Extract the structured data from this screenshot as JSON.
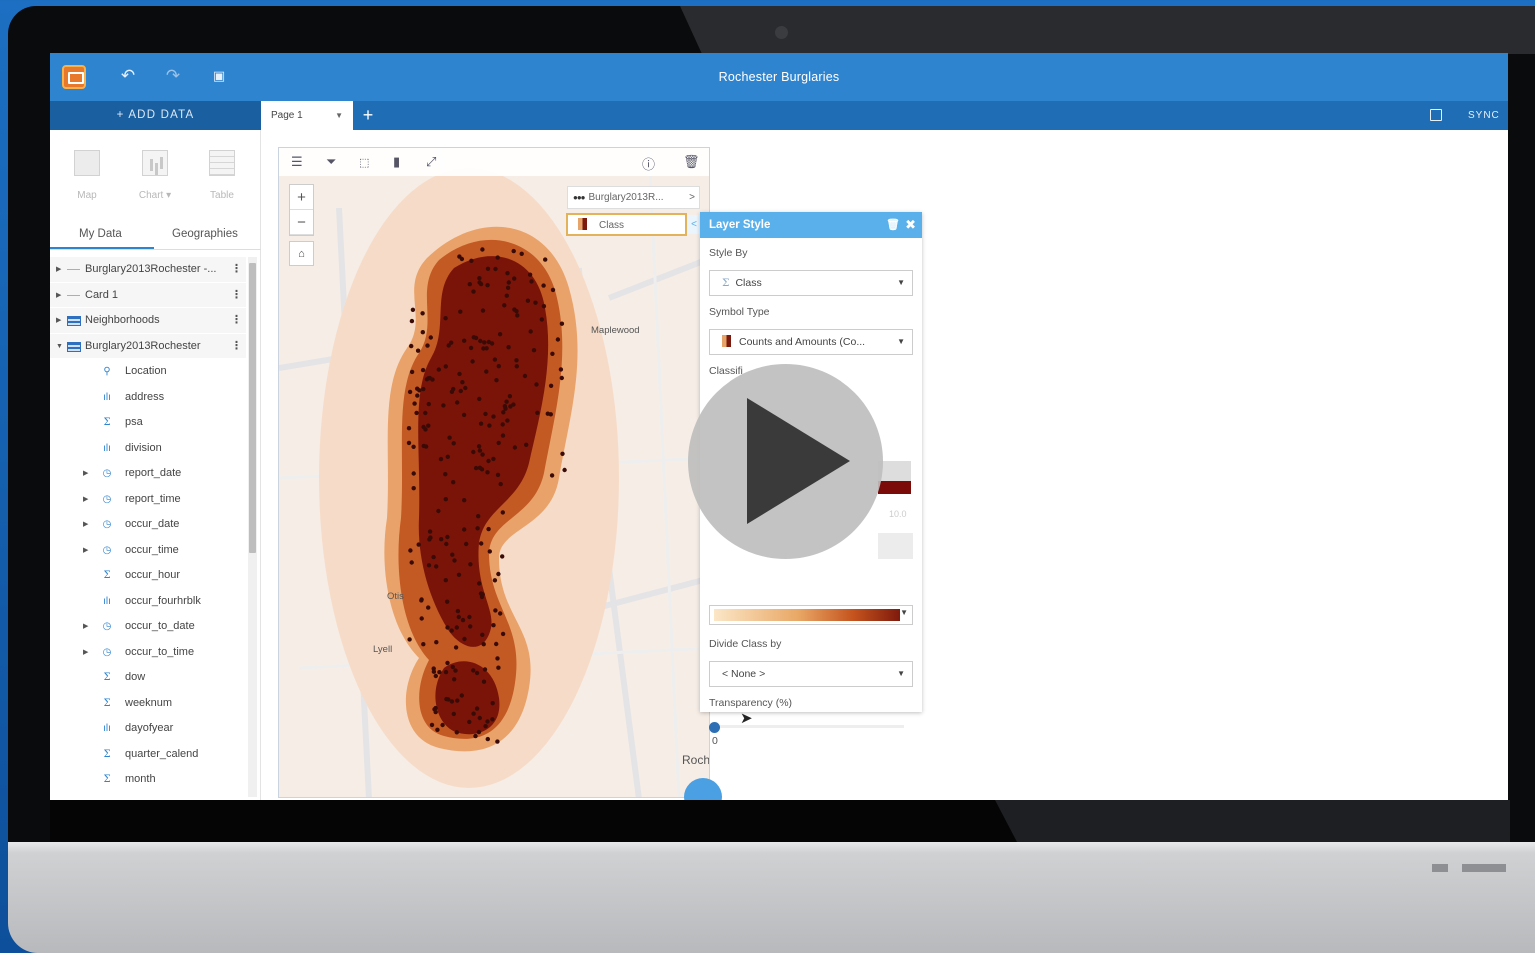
{
  "app": {
    "title": "Rochester Burglaries",
    "add_data_label": "+ ADD DATA",
    "page_tab_label": "Page 1",
    "page_add_label": "+",
    "sync_label": "SYNC"
  },
  "toolbar_icons": [
    "app-logo-icon",
    "undo-icon",
    "redo-icon",
    "save-icon"
  ],
  "sidebar": {
    "viz": [
      {
        "label": "Map",
        "icon": "map-icon"
      },
      {
        "label": "Chart ▾",
        "icon": "chart-icon"
      },
      {
        "label": "Table",
        "icon": "table-icon"
      }
    ],
    "tabs": [
      "My Data",
      "Geographies"
    ],
    "datasets": [
      {
        "label": "Burglary2013Rochester -...",
        "icon": "link-icon",
        "expanded": false
      },
      {
        "label": "Card 1",
        "icon": "link-icon",
        "expanded": false
      },
      {
        "label": "Neighborhoods",
        "icon": "table-icon",
        "expanded": false
      },
      {
        "label": "Burglary2013Rochester",
        "icon": "table-icon",
        "expanded": true
      }
    ],
    "fields": [
      {
        "label": "Location",
        "icon": "location",
        "expandable": false
      },
      {
        "label": "address",
        "icon": "string",
        "expandable": false
      },
      {
        "label": "psa",
        "icon": "number",
        "expandable": false
      },
      {
        "label": "division",
        "icon": "string",
        "expandable": false
      },
      {
        "label": "report_date",
        "icon": "date",
        "expandable": true
      },
      {
        "label": "report_time",
        "icon": "date",
        "expandable": true
      },
      {
        "label": "occur_date",
        "icon": "date",
        "expandable": true
      },
      {
        "label": "occur_time",
        "icon": "date",
        "expandable": true
      },
      {
        "label": "occur_hour",
        "icon": "number",
        "expandable": false
      },
      {
        "label": "occur_fourhrblk",
        "icon": "string",
        "expandable": false
      },
      {
        "label": "occur_to_date",
        "icon": "date",
        "expandable": true
      },
      {
        "label": "occur_to_time",
        "icon": "date",
        "expandable": true
      },
      {
        "label": "dow",
        "icon": "number",
        "expandable": false
      },
      {
        "label": "weeknum",
        "icon": "number",
        "expandable": false
      },
      {
        "label": "dayofyear",
        "icon": "string",
        "expandable": false
      },
      {
        "label": "quarter_calend",
        "icon": "number",
        "expandable": false
      },
      {
        "label": "month",
        "icon": "number",
        "expandable": false
      }
    ]
  },
  "map_card": {
    "legend_layer": "Burglary2013R...",
    "legend_layer_caret": ">",
    "legend_class": "Class",
    "legend_class_caret": "<",
    "zoom_in": "+",
    "zoom_out": "−",
    "place_labels": {
      "maplewood": "Maplewood",
      "otis": "Otis",
      "lyell": "Lyell",
      "roch": "Roch"
    }
  },
  "layer_style": {
    "title": "Layer Style",
    "style_by_label": "Style By",
    "style_by_value": "Class",
    "symbol_type_label": "Symbol Type",
    "symbol_type_value": "Counts and Amounts (Co...",
    "classification_label": "Classifi",
    "class_tick": "10.0",
    "divide_by_label": "Divide Class by",
    "divide_by_value": "< None >",
    "transparency_label": "Transparency (%)",
    "transparency_value": "0",
    "transparency": 0
  },
  "colors": {
    "topbar": "#2f84cf",
    "accent": "#2f84cf",
    "panel_header": "#5ab0ea",
    "hotspot_dark": "#7a1409",
    "hotspot_mid": "#c0622a",
    "hotspot_light": "#e9a36a"
  }
}
